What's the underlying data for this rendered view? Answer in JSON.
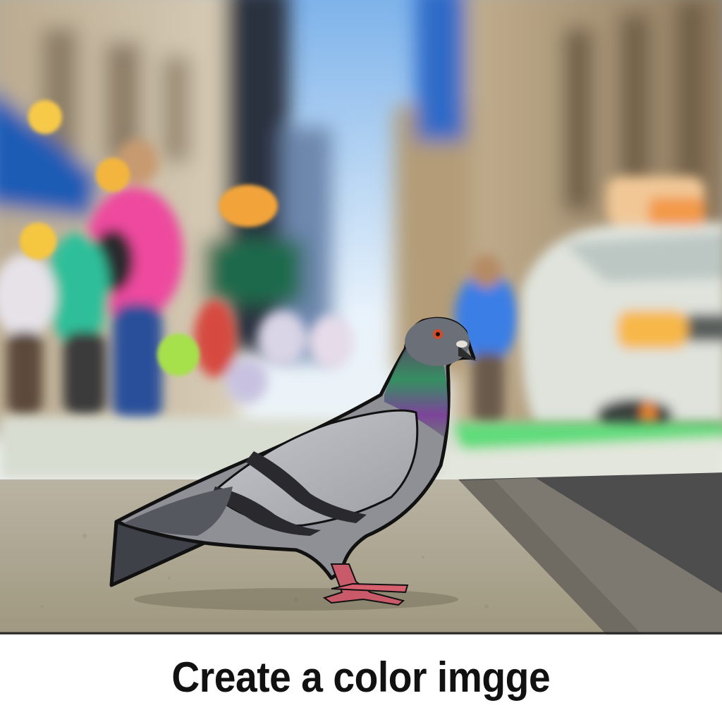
{
  "image": {
    "subject": "pigeon-on-city-sidewalk",
    "scene_colors": {
      "sidewalk": "#a8a18f",
      "pigeon_body": "#8e9095",
      "pigeon_neck": "#2f8a5e",
      "pigeon_feet": "#c85a6a",
      "awning": "#1f5bb5",
      "shirt": "#ee4a9e",
      "taxi_light": "#f7b84a"
    }
  },
  "caption": {
    "text": "Create a color imgge"
  }
}
